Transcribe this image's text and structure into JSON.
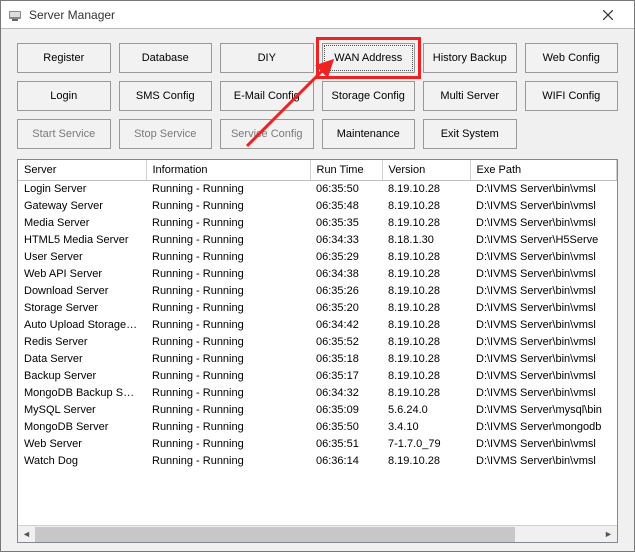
{
  "window": {
    "title": "Server Manager"
  },
  "buttons": [
    {
      "id": "register-button",
      "label": "Register",
      "disabled": false
    },
    {
      "id": "database-button",
      "label": "Database",
      "disabled": false
    },
    {
      "id": "diy-button",
      "label": "DIY",
      "disabled": false
    },
    {
      "id": "wan-address-button",
      "label": "WAN Address",
      "disabled": false,
      "highlighted": true
    },
    {
      "id": "history-backup-button",
      "label": "History Backup",
      "disabled": false
    },
    {
      "id": "web-config-button",
      "label": "Web Config",
      "disabled": false
    },
    {
      "id": "login-button",
      "label": "Login",
      "disabled": false
    },
    {
      "id": "sms-config-button",
      "label": "SMS Config",
      "disabled": false
    },
    {
      "id": "email-config-button",
      "label": "E-Mail Config",
      "disabled": false
    },
    {
      "id": "storage-config-button",
      "label": "Storage Config",
      "disabled": false
    },
    {
      "id": "multi-server-button",
      "label": "Multi Server",
      "disabled": false
    },
    {
      "id": "wifi-config-button",
      "label": "WIFI Config",
      "disabled": false
    },
    {
      "id": "start-service-button",
      "label": "Start Service",
      "disabled": true
    },
    {
      "id": "stop-service-button",
      "label": "Stop Service",
      "disabled": true
    },
    {
      "id": "service-config-button",
      "label": "Service Config",
      "disabled": true
    },
    {
      "id": "maintenance-button",
      "label": "Maintenance",
      "disabled": false
    },
    {
      "id": "exit-system-button",
      "label": "Exit System",
      "disabled": false
    }
  ],
  "table": {
    "headers": [
      "Server",
      "Information",
      "Run Time",
      "Version",
      "Exe Path"
    ],
    "rows": [
      {
        "server": "Login Server",
        "info": "Running - Running",
        "run_time": "06:35:50",
        "version": "8.19.10.28",
        "path": "D:\\IVMS Server\\bin\\vmsl"
      },
      {
        "server": "Gateway Server",
        "info": "Running - Running",
        "run_time": "06:35:48",
        "version": "8.19.10.28",
        "path": "D:\\IVMS Server\\bin\\vmsl"
      },
      {
        "server": "Media Server",
        "info": "Running - Running",
        "run_time": "06:35:35",
        "version": "8.19.10.28",
        "path": "D:\\IVMS Server\\bin\\vmsl"
      },
      {
        "server": "HTML5 Media Server",
        "info": "Running - Running",
        "run_time": "06:34:33",
        "version": "8.18.1.30",
        "path": "D:\\IVMS Server\\H5Serve"
      },
      {
        "server": "User Server",
        "info": "Running - Running",
        "run_time": "06:35:29",
        "version": "8.19.10.28",
        "path": "D:\\IVMS Server\\bin\\vmsl"
      },
      {
        "server": "Web API Server",
        "info": "Running - Running",
        "run_time": "06:34:38",
        "version": "8.19.10.28",
        "path": "D:\\IVMS Server\\bin\\vmsl"
      },
      {
        "server": "Download Server",
        "info": "Running - Running",
        "run_time": "06:35:26",
        "version": "8.19.10.28",
        "path": "D:\\IVMS Server\\bin\\vmsl"
      },
      {
        "server": "Storage Server",
        "info": "Running - Running",
        "run_time": "06:35:20",
        "version": "8.19.10.28",
        "path": "D:\\IVMS Server\\bin\\vmsl"
      },
      {
        "server": "Auto Upload Storage S...",
        "info": "Running - Running",
        "run_time": "06:34:42",
        "version": "8.19.10.28",
        "path": "D:\\IVMS Server\\bin\\vmsl"
      },
      {
        "server": "Redis Server",
        "info": "Running - Running",
        "run_time": "06:35:52",
        "version": "8.19.10.28",
        "path": "D:\\IVMS Server\\bin\\vmsl"
      },
      {
        "server": "Data Server",
        "info": "Running - Running",
        "run_time": "06:35:18",
        "version": "8.19.10.28",
        "path": "D:\\IVMS Server\\bin\\vmsl"
      },
      {
        "server": "Backup Server",
        "info": "Running - Running",
        "run_time": "06:35:17",
        "version": "8.19.10.28",
        "path": "D:\\IVMS Server\\bin\\vmsl"
      },
      {
        "server": "MongoDB Backup Server",
        "info": "Running - Running",
        "run_time": "06:34:32",
        "version": "8.19.10.28",
        "path": "D:\\IVMS Server\\bin\\vmsl"
      },
      {
        "server": "MySQL Server",
        "info": "Running - Running",
        "run_time": "06:35:09",
        "version": "5.6.24.0",
        "path": "D:\\IVMS Server\\mysql\\bin"
      },
      {
        "server": "MongoDB Server",
        "info": "Running - Running",
        "run_time": "06:35:50",
        "version": "3.4.10",
        "path": "D:\\IVMS Server\\mongodb"
      },
      {
        "server": "Web Server",
        "info": "Running - Running",
        "run_time": "06:35:51",
        "version": "7-1.7.0_79",
        "path": "D:\\IVMS Server\\bin\\vmsl"
      },
      {
        "server": "Watch Dog",
        "info": "Running - Running",
        "run_time": "06:36:14",
        "version": "8.19.10.28",
        "path": "D:\\IVMS Server\\bin\\vmsl"
      }
    ]
  }
}
